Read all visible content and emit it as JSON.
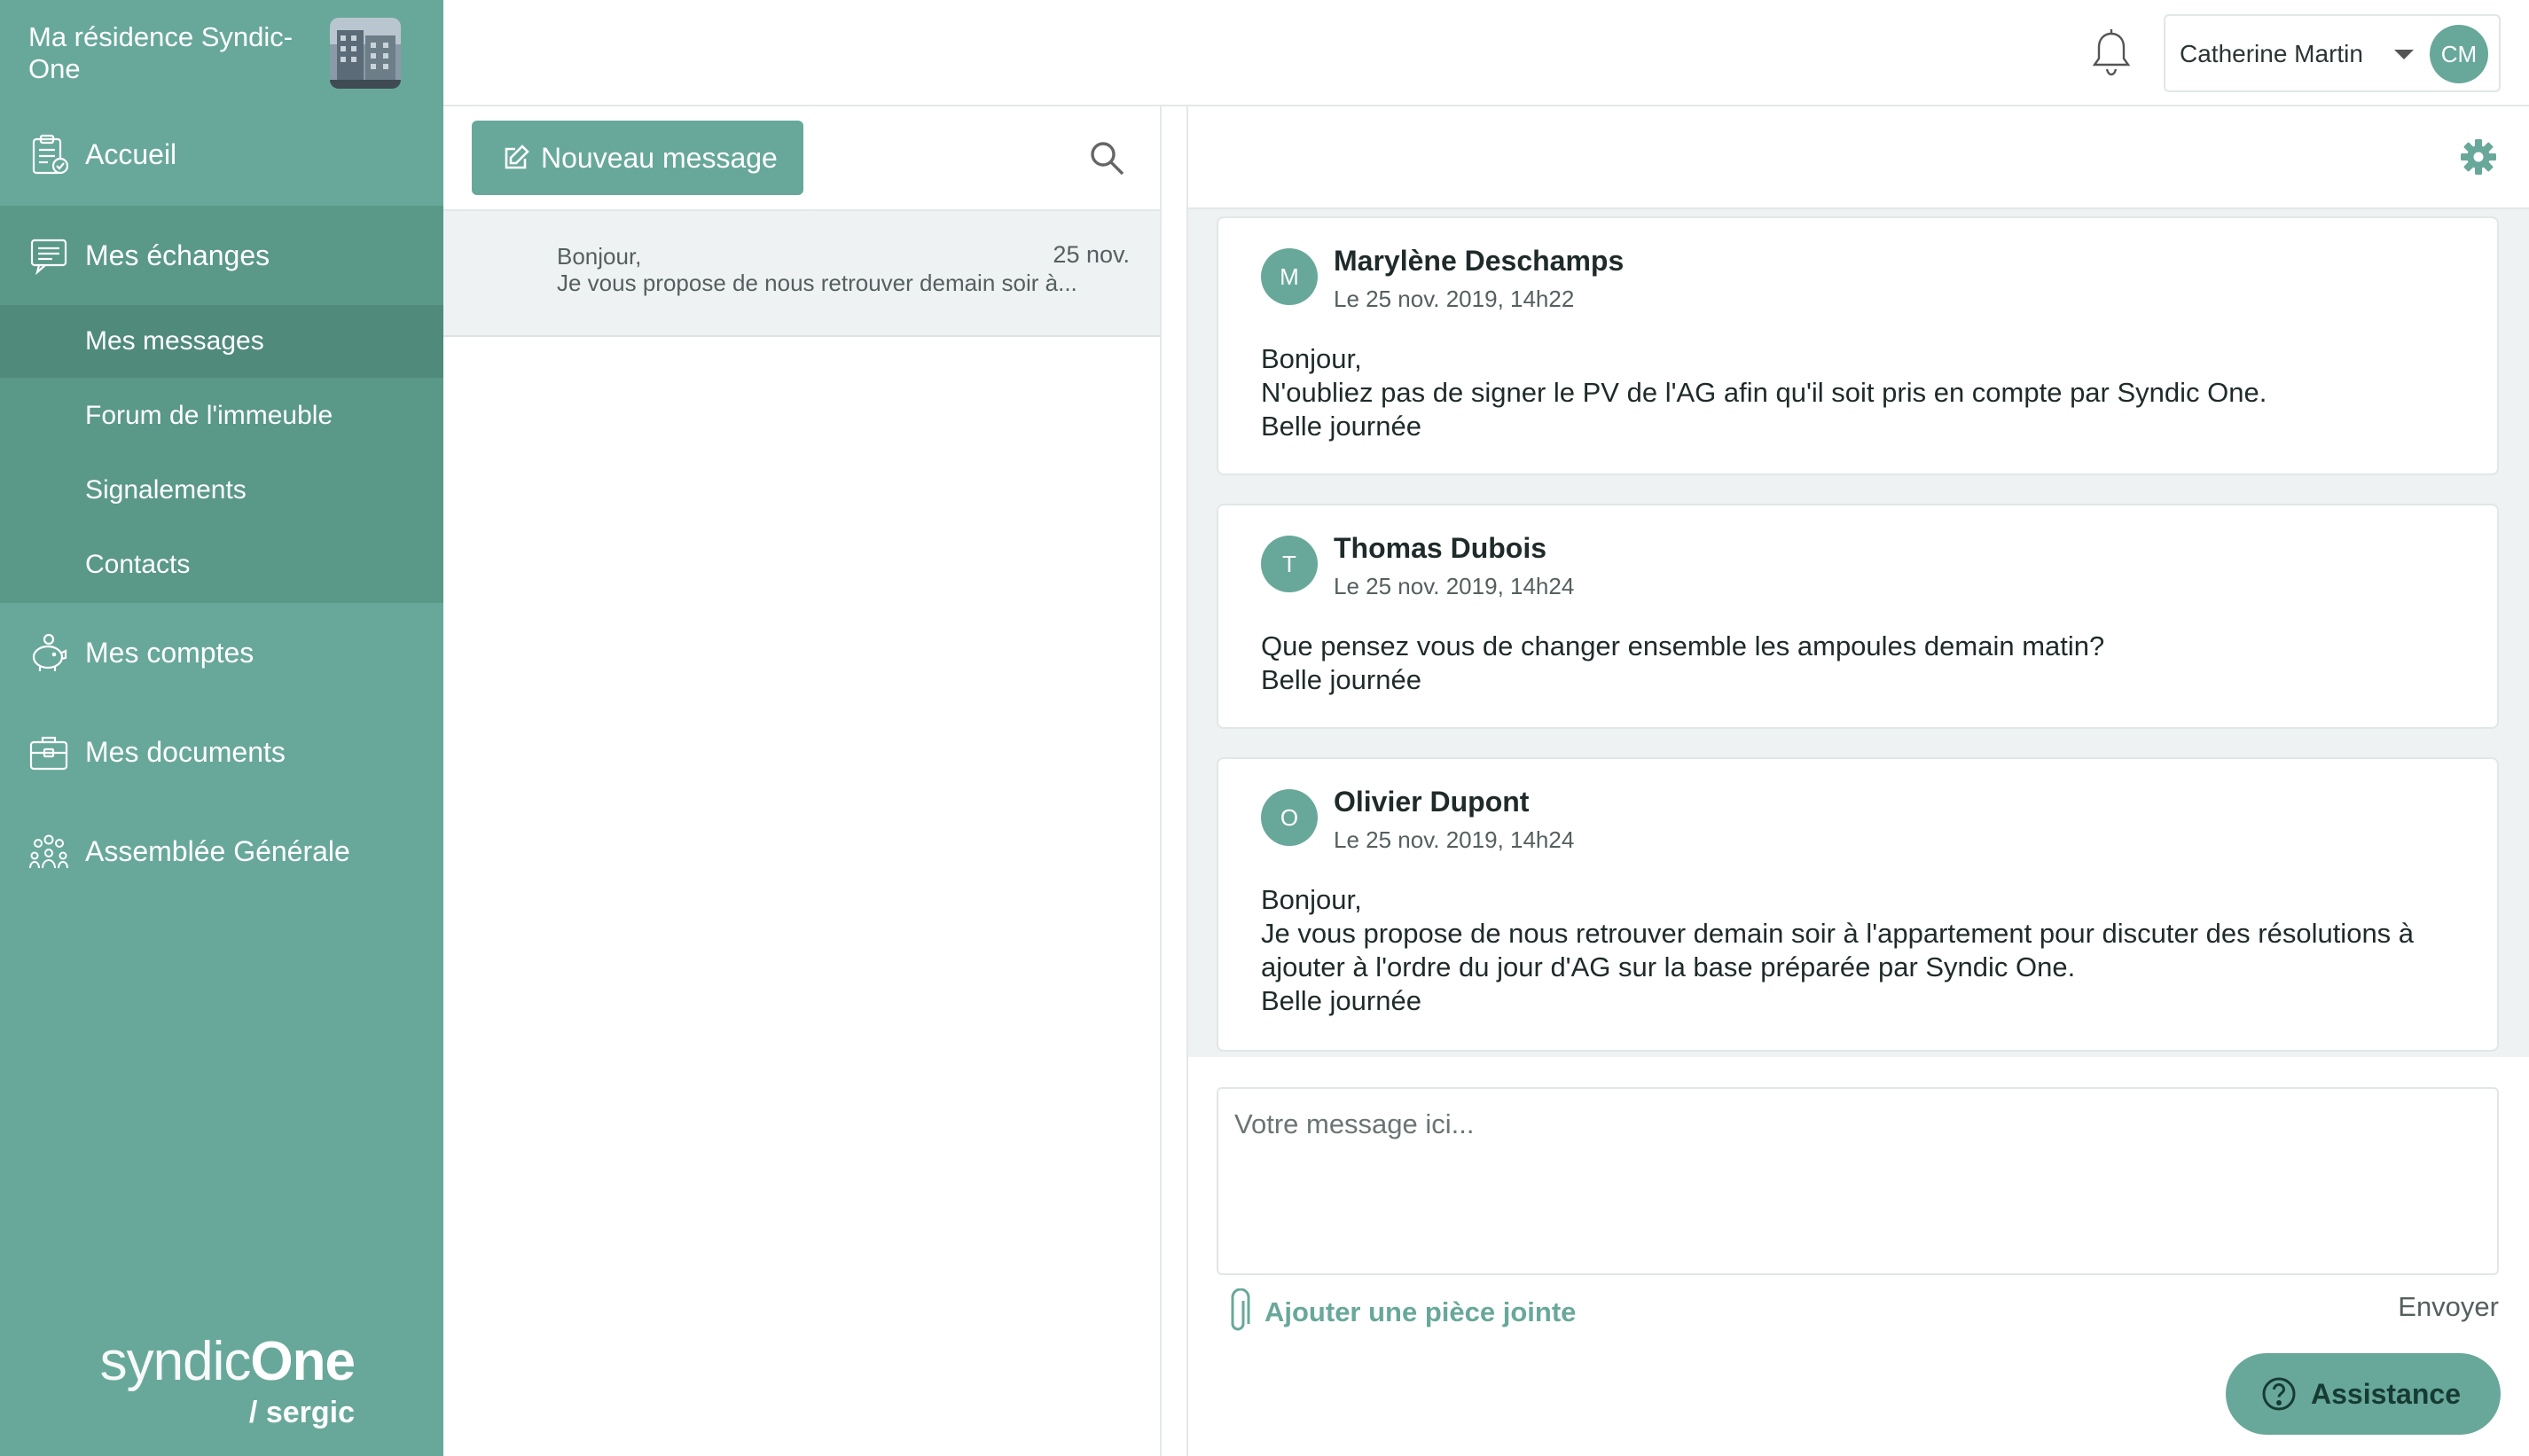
{
  "sidebar": {
    "residence_name": "Ma résidence Syndic-One",
    "nav": {
      "accueil": "Accueil",
      "echanges": "Mes échanges",
      "comptes": "Mes comptes",
      "documents": "Mes documents",
      "assemblee": "Assemblée Générale"
    },
    "submenu": {
      "messages": "Mes messages",
      "forum": "Forum de l'immeuble",
      "signalements": "Signalements",
      "contacts": "Contacts"
    },
    "brand": {
      "word1": "syndic",
      "word2": "One",
      "sub": "/ sergic"
    }
  },
  "topbar": {
    "user_name": "Catherine Martin",
    "user_initials": "CM"
  },
  "list": {
    "new_message_label": "Nouveau message",
    "conversations": [
      {
        "greeting": "Bonjour,",
        "preview": "Je vous propose de nous retrouver demain soir à...",
        "date": "25 nov."
      }
    ]
  },
  "thread": {
    "messages": [
      {
        "initial": "M",
        "author": "Marylène Deschamps",
        "date": "Le 25 nov. 2019, 14h22",
        "lines": [
          "Bonjour,",
          "N'oubliez pas de signer le PV de l'AG afin qu'il soit pris en compte par Syndic One.",
          "Belle journée"
        ]
      },
      {
        "initial": "T",
        "author": "Thomas Dubois",
        "date": "Le 25 nov. 2019, 14h24",
        "lines": [
          "Que pensez vous de changer ensemble les ampoules demain matin?",
          "Belle journée"
        ]
      },
      {
        "initial": "O",
        "author": "Olivier Dupont",
        "date": "Le 25 nov. 2019, 14h24",
        "lines": [
          "Bonjour,",
          "Je vous propose de nous retrouver demain soir à l'appartement pour discuter des résolutions à ajouter à l'ordre du jour d'AG sur la base préparée par Syndic One.",
          "Belle journée"
        ]
      }
    ],
    "composer_placeholder": "Votre message ici...",
    "attach_label": "Ajouter une pièce jointe",
    "send_label": "Envoyer",
    "assistance_label": "Assistance"
  },
  "colors": {
    "accent": "#68a89a",
    "accent_dark": "#5a9888",
    "selected": "#4f8a7b",
    "panel_bg": "#eef2f3"
  }
}
